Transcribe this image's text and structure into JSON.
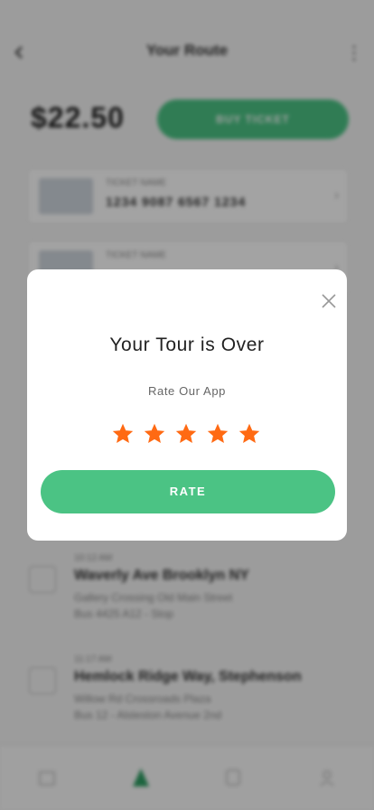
{
  "header": {
    "title": "Your Route"
  },
  "summary": {
    "price": "$22.50",
    "buy_label": "BUY TICKET"
  },
  "cards": [
    {
      "label": "TICKET NAME",
      "number": "1234 9087 6567 1234"
    },
    {
      "label": "TICKET NAME",
      "number": ""
    }
  ],
  "stops": [
    {
      "time": "10:12 AM",
      "address": "Waverly Ave Brooklyn NY",
      "line1": "Gallery Crossing Old Main Street",
      "line2": "Bus 4425 A12 - Stop"
    },
    {
      "time": "11:17 AM",
      "address": "Hemlock Ridge Way, Stephenson",
      "line1": "Willow Rd Crossroads Plaza",
      "line2": "Bus 12 - Alsteston Avenue 2nd"
    }
  ],
  "modal": {
    "title": "Your Tour is Over",
    "subtitle": "Rate Our App",
    "rating": 5,
    "rating_max": 5,
    "rate_label": "RATE",
    "star_color": "#ff6a13",
    "button_color": "#4bc384"
  }
}
